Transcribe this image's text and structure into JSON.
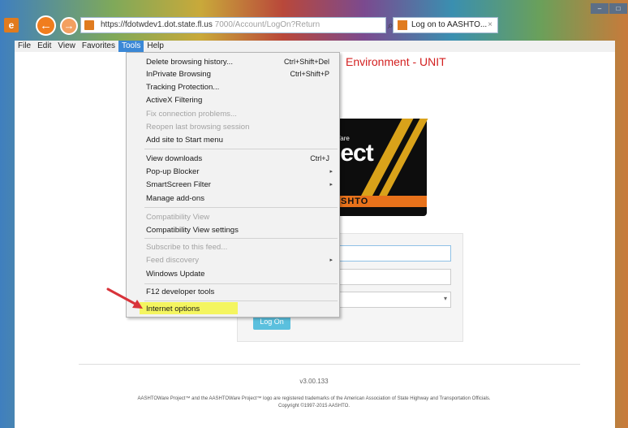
{
  "browser": {
    "address_host": "https://fdotwdev1.dot.state.fl.us",
    "address_path": "7000/Account/LogOn?Return",
    "tab_title": "Log on to AASHTO...",
    "tab_close": "×",
    "search_glyph": "⌕",
    "lock_glyph": "🔒",
    "refresh_glyph": "↻",
    "back_glyph": "←",
    "forward_glyph": "→"
  },
  "menubar": {
    "items": [
      {
        "label": "File"
      },
      {
        "label": "Edit"
      },
      {
        "label": "View"
      },
      {
        "label": "Favorites"
      },
      {
        "label": "Tools"
      },
      {
        "label": "Help"
      }
    ]
  },
  "tools_menu": {
    "items": [
      {
        "label": "Delete browsing history...",
        "shortcut": "Ctrl+Shift+Del"
      },
      {
        "label": "InPrivate Browsing",
        "shortcut": "Ctrl+Shift+P"
      },
      {
        "label": "Tracking Protection..."
      },
      {
        "label": "ActiveX Filtering"
      },
      {
        "label": "Fix connection problems..."
      },
      {
        "label": "Reopen last browsing session"
      },
      {
        "label": "Add site to Start menu"
      },
      {
        "label": "View downloads",
        "shortcut": "Ctrl+J"
      },
      {
        "label": "Pop-up Blocker",
        "submenu": "▸"
      },
      {
        "label": "SmartScreen Filter",
        "submenu": "▸"
      },
      {
        "label": "Manage add-ons"
      },
      {
        "label": "Compatibility View"
      },
      {
        "label": "Compatibility View settings"
      },
      {
        "label": "Subscribe to this feed..."
      },
      {
        "label": "Feed discovery",
        "submenu": "▸"
      },
      {
        "label": "Windows Update"
      },
      {
        "label": "F12 developer tools"
      },
      {
        "label": "Internet options"
      }
    ],
    "highlight_color": "#f4f560"
  },
  "page": {
    "env_title": "Environment - UNIT",
    "logo_small": "Ware",
    "logo_word": "ject",
    "logo_band": "SHTO",
    "login_button": "Log On",
    "version": "v3.00.133",
    "legal_line1": "AASHTOWare Project™ and the AASHTOWare Project™ logo are registered trademarks of the American Association of State Highway and Transportation Officials.",
    "legal_line2": "Copyright ©1997-2015 AASHTO."
  },
  "colors": {
    "accent_orange": "#f07d1e",
    "menu_active": "#3b88d6",
    "env_title_red": "#d32020",
    "login_button": "#5bc0de",
    "arrow_red": "#d8333a"
  }
}
